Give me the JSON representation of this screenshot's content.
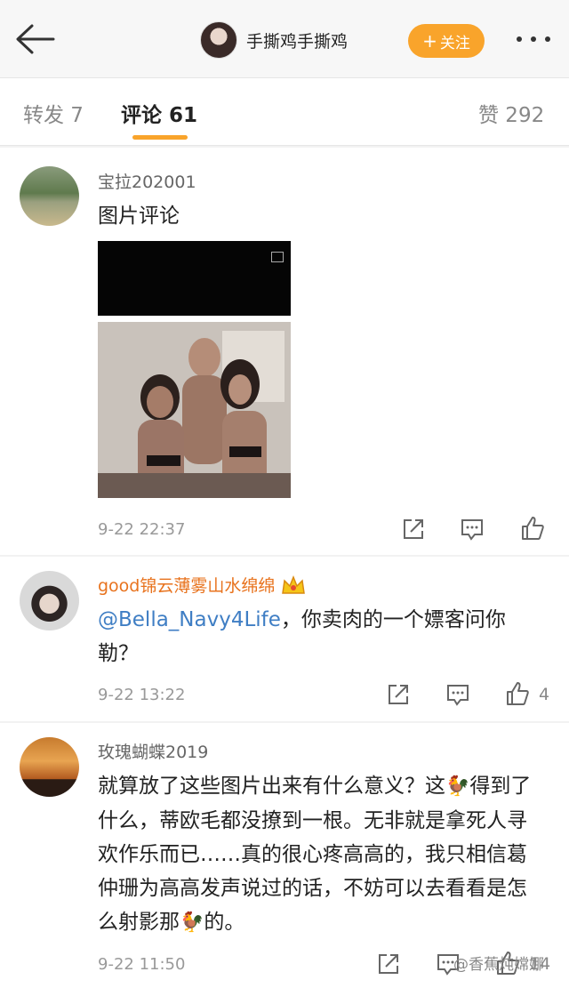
{
  "header": {
    "username": "手撕鸡手撕鸡",
    "follow_label": "关注",
    "follow_plus": "+"
  },
  "tabs": {
    "repost": "转发 7",
    "comments": "评论 61",
    "likes": "赞 292"
  },
  "comments": [
    {
      "user": "宝拉202001",
      "text": "图片评论",
      "time": "9-22 22:37",
      "likes": ""
    },
    {
      "user": "good锦云薄雾山水绵绵",
      "mention": "@Bella_Navy4Life",
      "text_after_mention": "，你卖肉的一个嫖客问你勒？",
      "time": "9-22 13:22",
      "likes": "4"
    },
    {
      "user": "玫瑰蝴蝶2019",
      "text_parts": [
        "就算放了这些图片出来有什么意义？这",
        "得到了什么，蒂欧毛都没撩到一根。无非就是拿死人寻欢作乐而已……真的很心疼高高的，我只相信葛仲珊为高高发声说过的话，不妨可以去看看是怎么射影那",
        "的。"
      ],
      "time": "9-22 11:50",
      "likes": "14"
    }
  ],
  "watermark": "@香蕉炖嫦娜",
  "colors": {
    "accent": "#f9a42b",
    "link": "#3f7ec4",
    "vip_name": "#e8731e"
  }
}
